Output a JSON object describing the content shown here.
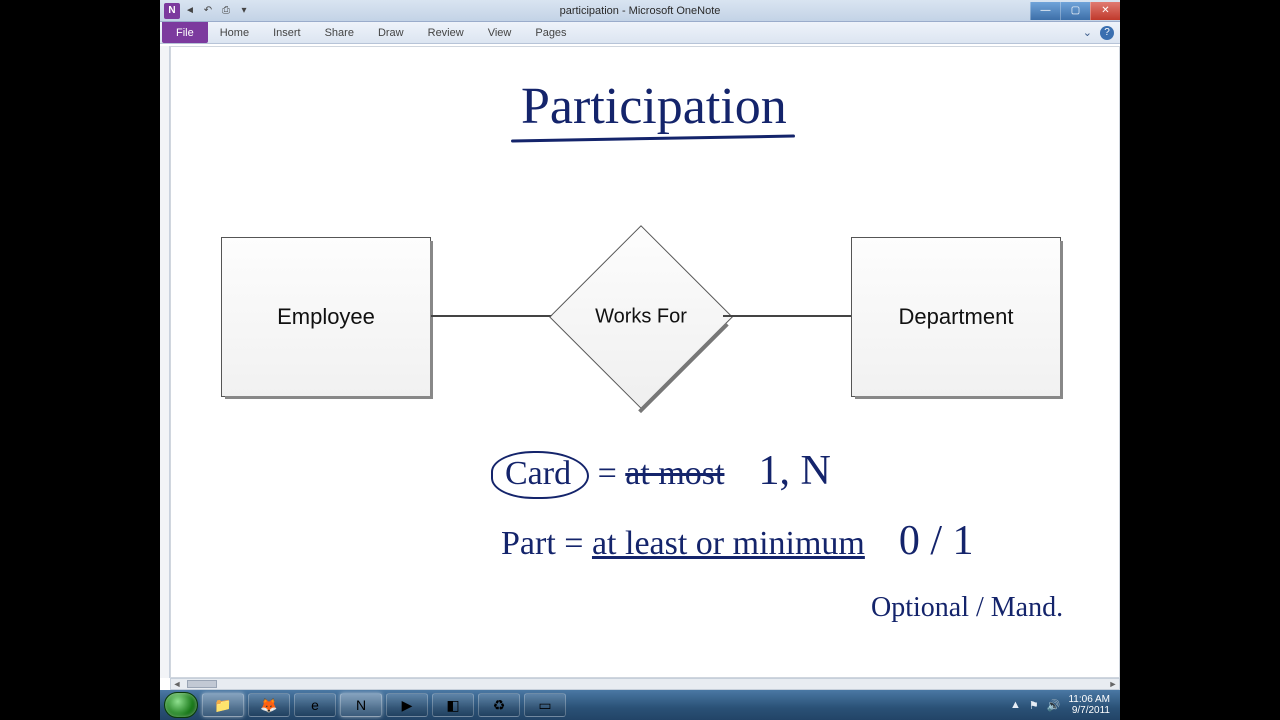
{
  "window": {
    "title": "participation - Microsoft OneNote",
    "qat_icons": [
      "onenote-icon",
      "back-icon",
      "undo-icon",
      "print-icon",
      "dropdown-icon"
    ]
  },
  "ribbon": {
    "file": "File",
    "tabs": [
      "Home",
      "Insert",
      "Share",
      "Draw",
      "Review",
      "View",
      "Pages"
    ],
    "collapse_glyph": "⌄",
    "help_glyph": "?"
  },
  "diagram": {
    "entity_left": "Employee",
    "relation": "Works For",
    "entity_right": "Department",
    "hw_title": "Participation",
    "hw_card_circled": "Card",
    "hw_card_eq": "=",
    "hw_card_struck": "at most",
    "hw_card_vals": "1, N",
    "hw_part_label": "Part",
    "hw_part_eq": "=",
    "hw_part_under": "at least or minimum",
    "hw_part_vals": "0 / 1",
    "hw_optional": "Optional / Mand."
  },
  "taskbar": {
    "items": [
      {
        "name": "explorer-icon",
        "glyph": "📁",
        "active": true
      },
      {
        "name": "firefox-icon",
        "glyph": "🦊",
        "active": false
      },
      {
        "name": "ie-icon",
        "glyph": "e",
        "active": false
      },
      {
        "name": "onenote-icon",
        "glyph": "N",
        "active": true
      },
      {
        "name": "media-icon",
        "glyph": "▶",
        "active": false
      },
      {
        "name": "app-icon",
        "glyph": "◧",
        "active": false
      },
      {
        "name": "recycle-icon",
        "glyph": "♻",
        "active": false
      },
      {
        "name": "app2-icon",
        "glyph": "▭",
        "active": false
      }
    ],
    "tray": {
      "chevron": "▲",
      "flag": "⚑",
      "speaker": "🔊",
      "time": "11:06 AM",
      "date": "9/7/2011"
    }
  }
}
